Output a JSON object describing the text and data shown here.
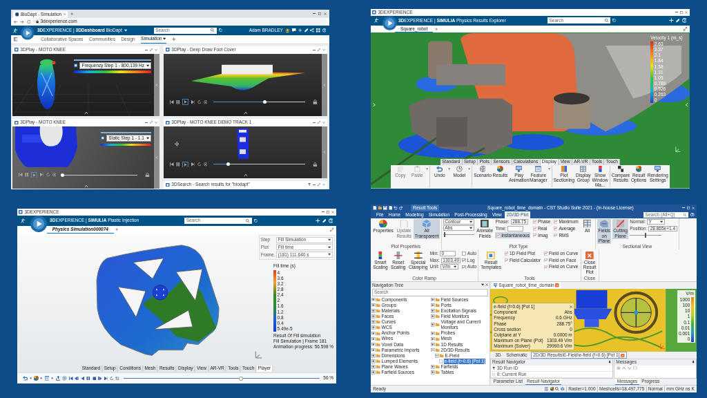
{
  "top_left": {
    "browser_tab": {
      "title": "BioDapt - Simulation"
    },
    "address": "3dexperience.com",
    "app_title": "**3D**EXPERIENCE | **3DDashboard** BioDapt",
    "search": {
      "placeholder": "Search"
    },
    "user": "Adam BRADLEY",
    "tabs": [
      {
        "label": "Collaborative Spaces",
        "selected": false
      },
      {
        "label": "Communities",
        "selected": false
      },
      {
        "label": "Design",
        "selected": false
      },
      {
        "label": "Simulation",
        "selected": true
      }
    ],
    "widgets": [
      {
        "title": "3DPlay - MOTO KNEE",
        "step": "Frequency Step 1 - 800.139 Hz"
      },
      {
        "title": "3DPlay - Deep Draw Foot Cover",
        "player": {
          "level": 0.56
        }
      },
      {
        "title": "3DPlay - MOTO KNEE",
        "step": "Static Step 1 - 1.1",
        "player": {
          "level": 0
        }
      },
      {
        "title": "3DPlay - MOTO KNEE DEMO TRACK 1",
        "player": {
          "level": 0.16
        }
      },
      {
        "title": "3DSearch - Search results for \"biodapt\""
      }
    ]
  },
  "top_right": {
    "window_title": "3DEXPERIENCE",
    "app_title": "**3D**EXPERIENCE | **SIMULIA** Physics Results Explorer",
    "search": {
      "placeholder": "Search"
    },
    "tabs": [
      {
        "label": "Square_robot",
        "selected": true
      }
    ],
    "legend": {
      "title": "Velocity 1 (m_s)",
      "values": [
        "2.63",
        "2.37",
        "2.1",
        "1.84",
        "1.58",
        "1.31",
        "1.05",
        "0.789",
        "0.526",
        "0.263",
        "0"
      ]
    },
    "toolbar_tabs": [
      {
        "label": "Standard",
        "selected": false
      },
      {
        "label": "Setup",
        "selected": false
      },
      {
        "label": "Plots",
        "selected": false
      },
      {
        "label": "Sensors",
        "selected": false
      },
      {
        "label": "Calculations",
        "selected": false
      },
      {
        "label": "Display",
        "selected": true
      },
      {
        "label": "View",
        "selected": false
      },
      {
        "label": "AR-VR",
        "selected": false
      },
      {
        "label": "Tools",
        "selected": false
      },
      {
        "label": "Touch",
        "selected": false
      }
    ],
    "toolbar_buttons": [
      {
        "label": "Copy",
        "disabled": true
      },
      {
        "label": "Paste",
        "disabled": true
      },
      {
        "label": "Undo",
        "disabled": false
      },
      {
        "label": "Model",
        "disabled": false
      },
      {
        "label": "Scenario",
        "disabled": false
      },
      {
        "label": "Results",
        "disabled": false
      },
      {
        "label": "Play Animation",
        "disabled": false
      },
      {
        "label": "Feature Manager",
        "disabled": false
      },
      {
        "label": "Plot Sectioning",
        "disabled": false
      },
      {
        "label": "Display Group",
        "disabled": false
      },
      {
        "label": "Show Window Ma...",
        "disabled": false
      },
      {
        "label": "Compare Results",
        "disabled": false
      },
      {
        "label": "Result Options",
        "disabled": false
      },
      {
        "label": "Rendering Settings",
        "disabled": false
      }
    ]
  },
  "bottom_left": {
    "window_title": "3DEXPERIENCE",
    "app_title": "**3D**EXPERIENCE | **SIMULIA** Plastic Injection",
    "search": {
      "placeholder": "Search"
    },
    "tabs": [
      {
        "label": "Physics Simulation000074",
        "selected": true
      }
    ],
    "settings": [
      {
        "label": "Step",
        "value": "Fill Simulation"
      },
      {
        "label": "Plot",
        "value": "Fill time"
      },
      {
        "label": "Frame",
        "value": "(181) 111.640 s"
      }
    ],
    "legend": {
      "title": "Fill time (s)",
      "values": [
        "4",
        "3.6",
        "3.2",
        "2.8",
        "2.4",
        "2",
        "1.6",
        "1.2",
        "0.8",
        "0.4",
        "5.49e-5"
      ]
    },
    "result_lines": [
      "Result Of Fill simulation",
      "Fill Simulation | Frame 181",
      "Animation progress: 56.598 %"
    ],
    "toolbar_tabs": [
      {
        "label": "Standard",
        "selected": false
      },
      {
        "label": "Setup",
        "selected": false
      },
      {
        "label": "Conditions",
        "selected": false
      },
      {
        "label": "Mesh",
        "selected": false
      },
      {
        "label": "Results",
        "selected": false
      },
      {
        "label": "Display",
        "selected": false
      },
      {
        "label": "View",
        "selected": false
      },
      {
        "label": "AR-VR",
        "selected": false
      },
      {
        "label": "Tools",
        "selected": false
      },
      {
        "label": "Touch",
        "selected": false
      },
      {
        "label": "Player",
        "selected": true
      }
    ],
    "player": {
      "level": 0.6,
      "reading": "56 %"
    }
  },
  "bottom_right": {
    "title": "Square_robot_time_domain - CST Studio Suite 2021 - (In-house License)",
    "context_label": "Result Tools",
    "ribbon_tabs": [
      {
        "label": "File",
        "selected": false
      },
      {
        "label": "Home",
        "selected": false
      },
      {
        "label": "Modeling",
        "selected": false
      },
      {
        "label": "Simulation",
        "selected": false
      },
      {
        "label": "Post-Processing",
        "selected": false
      },
      {
        "label": "View",
        "selected": false
      },
      {
        "label": "2D/3D Plot",
        "selected": true
      }
    ],
    "search": {
      "placeholder": "Search (Alt+Q)"
    },
    "ribbon_groups": [
      {
        "label": "Plot Properties",
        "columns": [
          [
            {
              "kind": "large",
              "label": "Properties",
              "disabled": false,
              "selected": false
            }
          ],
          [
            {
              "kind": "large",
              "label": "Update Results",
              "disabled": true,
              "selected": false
            }
          ],
          [
            {
              "kind": "large",
              "label": "All Transparent",
              "disabled": false,
              "selected": true
            }
          ]
        ]
      },
      {
        "label": "Plot Type",
        "columns": [
          [
            {
              "kind": "dropdown",
              "value": "Contour"
            },
            {
              "kind": "dropdown",
              "value": "Abs"
            },
            {
              "kind": "slider",
              "level": 0.05
            }
          ],
          [
            {
              "kind": "large",
              "label": "Animate Fields",
              "disabled": false,
              "selected": false
            }
          ],
          [
            {
              "kind": "field",
              "label": "Phase:",
              "value": "288.75"
            },
            {
              "kind": "field",
              "label": "Time:"
            },
            {
              "kind": "small",
              "label": "Instantaneous",
              "selected": true
            }
          ],
          [
            {
              "kind": "small",
              "label": "Phase",
              "selected": false
            },
            {
              "kind": "small",
              "label": "Real",
              "selected": false
            },
            {
              "kind": "small",
              "label": "Imag",
              "selected": false
            }
          ],
          [
            {
              "kind": "small",
              "label": "Maximum",
              "selected": false
            },
            {
              "kind": "small",
              "label": "Average",
              "selected": false
            },
            {
              "kind": "small",
              "label": "RMS",
              "selected": false
            }
          ],
          [
            {
              "kind": "large",
              "label": "All",
              "disabled": false,
              "selected": false
            }
          ]
        ]
      },
      {
        "label": "Sectional View",
        "columns": [
          [
            {
              "kind": "large",
              "label": "Fields on Plane",
              "disabled": false,
              "selected": true
            }
          ],
          [
            {
              "kind": "large",
              "label": "Cutting Plane",
              "disabled": false,
              "selected": true
            }
          ],
          [
            {
              "kind": "select",
              "label": "Normal:",
              "value": "Y"
            },
            {
              "kind": "field",
              "label": "Position:",
              "value": "28.865e+1.4"
            },
            {
              "kind": "slider",
              "level": 0.5
            }
          ]
        ]
      },
      {
        "label": "Color Ramp",
        "columns": [
          [
            {
              "kind": "large",
              "label": "Smart Scaling",
              "disabled": false,
              "selected": false
            }
          ],
          [
            {
              "kind": "large",
              "label": "Reset Scaling",
              "disabled": false,
              "selected": false
            }
          ],
          [
            {
              "kind": "large",
              "label": "Special Clamping",
              "disabled": false,
              "selected": false
            }
          ],
          [
            {
              "kind": "field",
              "label": "Min:",
              "value": "0"
            },
            {
              "kind": "field",
              "label": "Max:",
              "value": "1303.49"
            },
            {
              "kind": "select",
              "label": "Unit:",
              "value": "V/m"
            }
          ],
          [
            {
              "kind": "check",
              "label": "Auto",
              "checked": false
            },
            {
              "kind": "check",
              "label": "Log",
              "checked": true
            },
            {
              "kind": "check",
              "label": "Auto",
              "checked": true
            }
          ]
        ]
      },
      {
        "label": "Tools",
        "columns": [
          [
            {
              "kind": "large",
              "label": "Result Templates",
              "disabled": false,
              "selected": false
            }
          ],
          [
            {
              "kind": "small",
              "label": "1D Field Plot",
              "selected": false
            },
            {
              "kind": "small",
              "label": "Field Calculator",
              "selected": false
            }
          ],
          [
            {
              "kind": "small",
              "label": "Field on Curve",
              "selected": false
            },
            {
              "kind": "small",
              "label": "Field on Face",
              "selected": false
            },
            {
              "kind": "small",
              "label": "Field on Curve",
              "selected": false
            }
          ]
        ]
      },
      {
        "label": "Close",
        "columns": [
          [
            {
              "kind": "large",
              "label": "Close Result Plot",
              "disabled": false,
              "selected": false
            }
          ]
        ]
      }
    ],
    "navigation_tree": {
      "title": "Navigation Tree",
      "search": {
        "placeholder": "Search"
      },
      "items": [
        {
          "label": "Components",
          "expanded": false,
          "selected": false
        },
        {
          "label": "Groups",
          "expanded": false,
          "selected": false
        },
        {
          "label": "Materials",
          "expanded": false,
          "selected": false
        },
        {
          "label": "Faces",
          "expanded": false,
          "selected": false
        },
        {
          "label": "Curves",
          "expanded": false,
          "selected": false
        },
        {
          "label": "WCS",
          "expanded": false,
          "selected": false
        },
        {
          "label": "Anchor Points",
          "expanded": false,
          "selected": false
        },
        {
          "label": "Wires",
          "expanded": false,
          "selected": false
        },
        {
          "label": "Voxel Data",
          "expanded": false,
          "selected": false
        },
        {
          "label": "Parametric Imports",
          "expanded": false,
          "selected": false
        },
        {
          "label": "Dimensions",
          "expanded": false,
          "selected": false
        },
        {
          "label": "Lumped Elements",
          "expanded": false,
          "selected": false
        },
        {
          "label": "Plane Waves",
          "expanded": false,
          "selected": false
        },
        {
          "label": "Farfield Sources",
          "expanded": false,
          "selected": false
        },
        {
          "label": "Field Sources",
          "expanded": false,
          "selected": false
        },
        {
          "label": "Ports",
          "expanded": false,
          "selected": false
        },
        {
          "label": "Excitation Signals",
          "expanded": false,
          "selected": false
        },
        {
          "label": "Field Monitors",
          "expanded": false,
          "selected": false
        },
        {
          "label": "Voltage and Current Monitors",
          "expanded": false,
          "selected": false
        },
        {
          "label": "Probes",
          "expanded": false,
          "selected": false
        },
        {
          "label": "Mesh",
          "expanded": false,
          "selected": false
        },
        {
          "label": "1D Results",
          "expanded": false,
          "selected": false
        },
        {
          "label": "2D/3D Results",
          "expanded": true,
          "selected": false,
          "children": [
            {
              "label": "E-Field",
              "expanded": true,
              "selected": false,
              "children": [
                {
                  "label": "e-field (f=0.6) [Pot 1]",
                  "selected": true
                }
              ]
            }
          ]
        },
        {
          "label": "Farfields",
          "expanded": false,
          "selected": false
        },
        {
          "label": "Tables",
          "expanded": false,
          "selected": false
        }
      ]
    },
    "document_tabs": [
      {
        "label": "Square_robot_time_domain",
        "selected": true
      }
    ],
    "legend": {
      "title": "V/m",
      "values": [
        "1000",
        "100",
        "10",
        "1",
        "0.1",
        "0.01",
        "0.001",
        "0"
      ]
    },
    "info_box": {
      "title": "e-field (f=0.6) [Pot 1]",
      "rows": [
        {
          "label": "Component",
          "value": "Abs"
        },
        {
          "label": "Frequency",
          "value": "0.6 GHz"
        },
        {
          "label": "Phase",
          "value": "288.75°"
        },
        {
          "label": "Cross section",
          "value": "0"
        },
        {
          "label": "Cutplane at Y",
          "value": "0.0000 m"
        },
        {
          "label": "Maximum on Plane (Pot)",
          "value": "1303.49 V/m"
        },
        {
          "label": "Maximum (Solver)",
          "value": "29990.6 V/m"
        }
      ]
    },
    "view_tabs": [
      {
        "label": "3D",
        "selected": false
      },
      {
        "label": "Schematic",
        "selected": false
      },
      {
        "label": "2D/3D Results\\E-Field\\e-field (f=0.6) [Pot 1]",
        "selected": true
      }
    ],
    "result_navigator": {
      "title": "Result Navigator",
      "rows": [
        "3D Run ID",
        "0: Current Run"
      ]
    },
    "messages": {
      "title": "Messages"
    },
    "bottom_tabs_left": [
      {
        "label": "Parameter List",
        "selected": false
      },
      {
        "label": "Result Navigator",
        "selected": true
      }
    ],
    "bottom_tabs_right": [
      {
        "label": "Messages",
        "selected": true
      },
      {
        "label": "Progress",
        "selected": false
      }
    ],
    "status": {
      "text": "Ready",
      "fields": [
        "Raster=1.000",
        "Meshcells=18,497,775",
        "Normal",
        "mm GHz ns K"
      ]
    }
  }
}
